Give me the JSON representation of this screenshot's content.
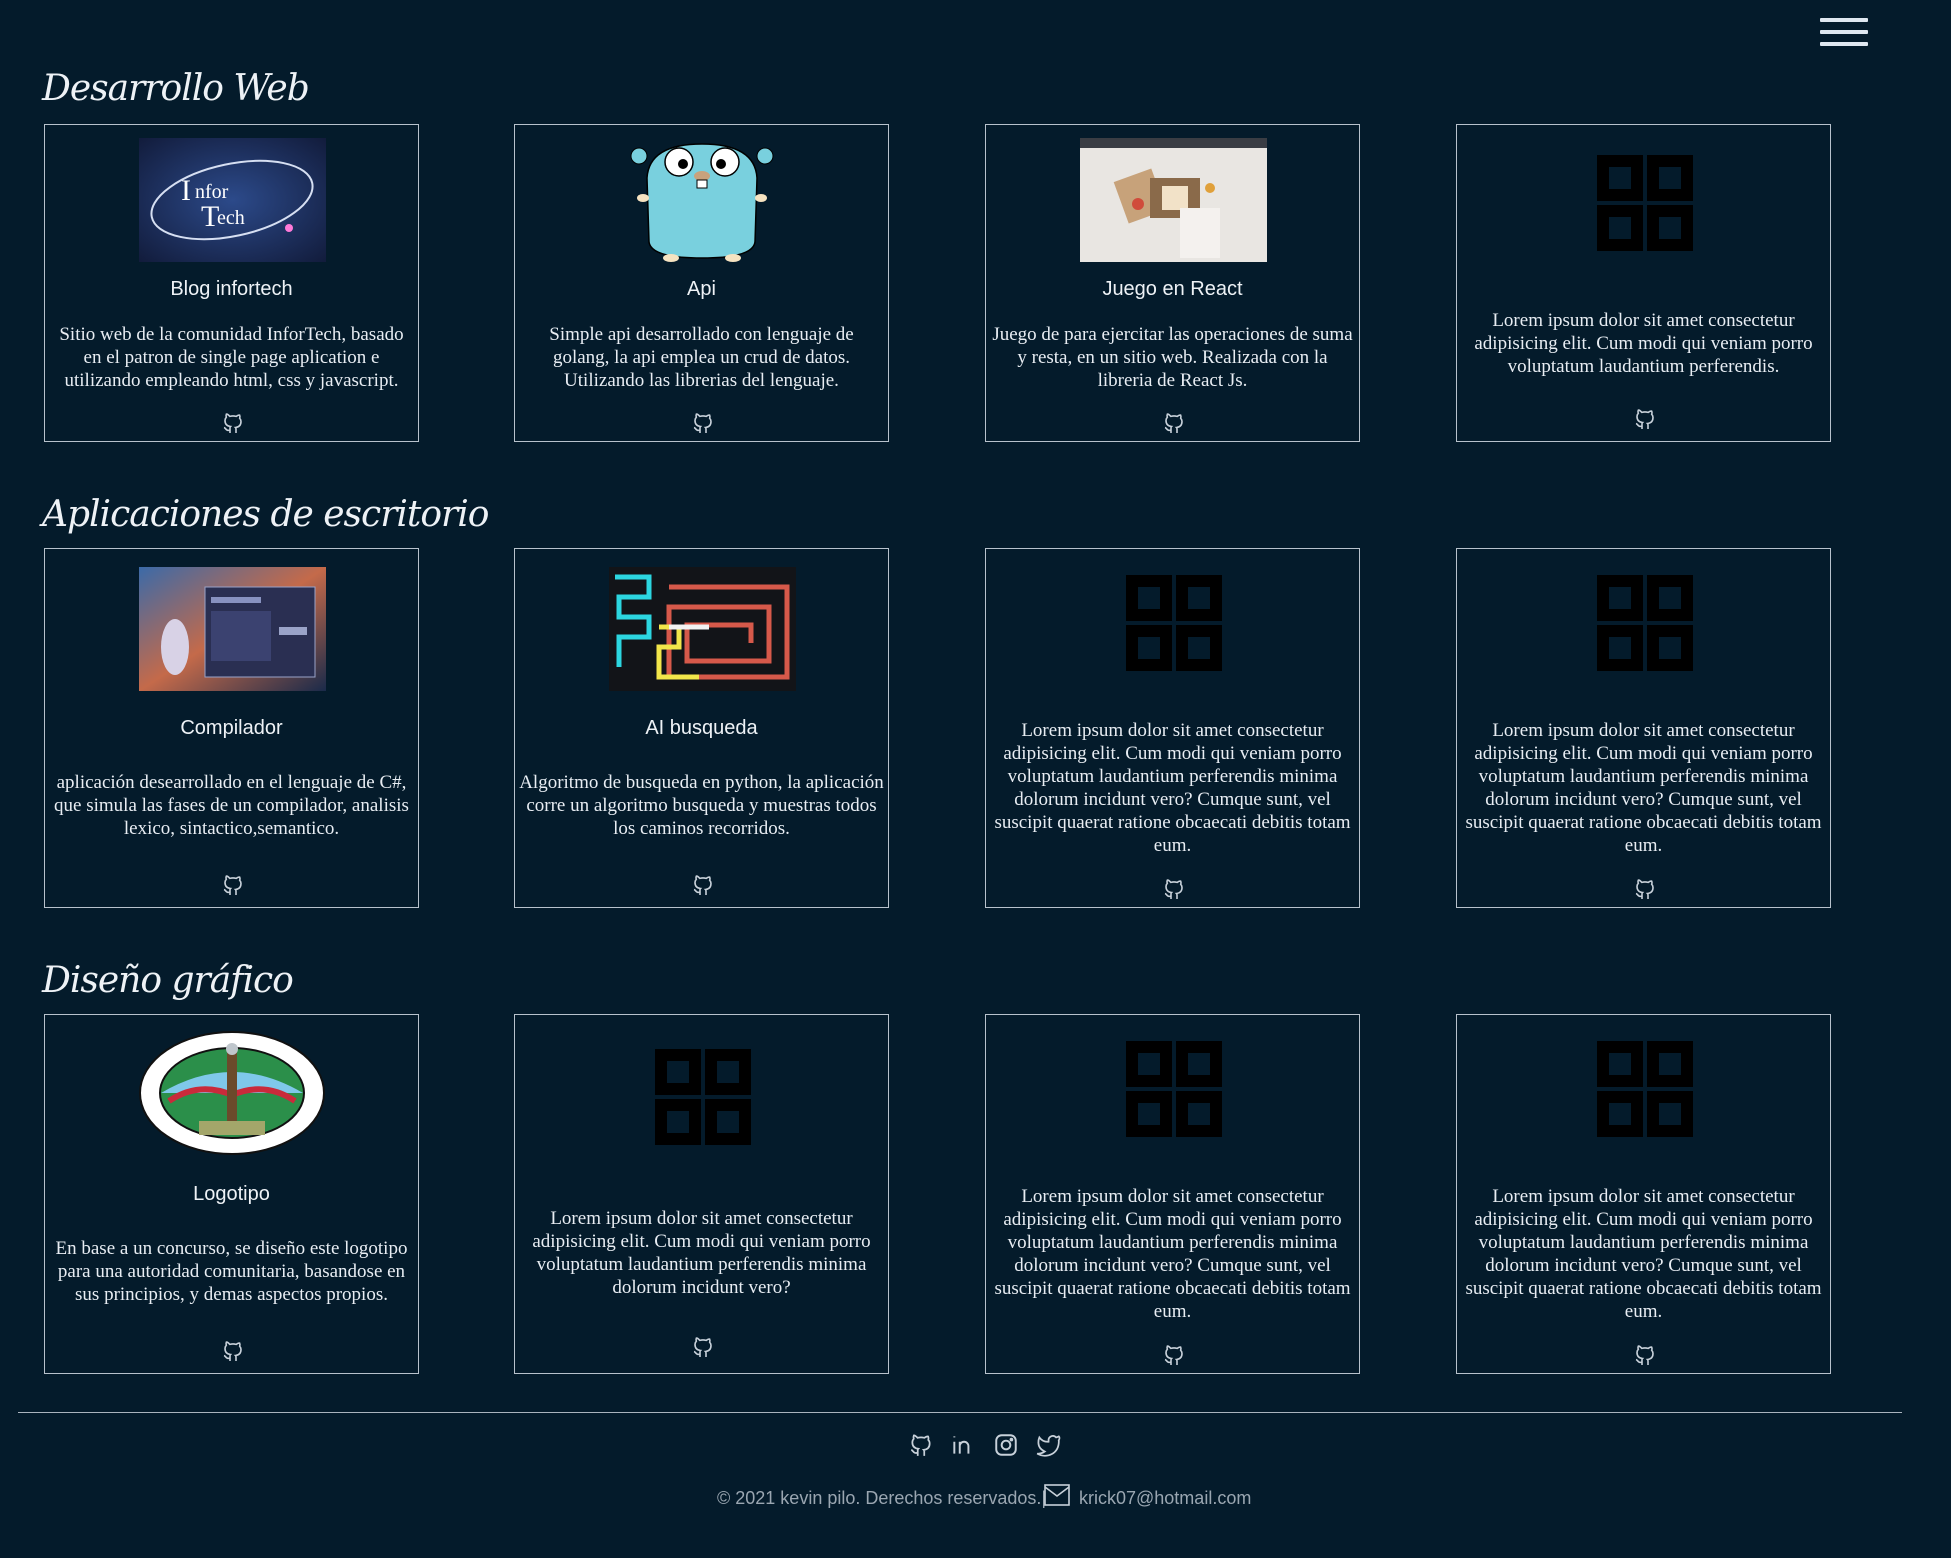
{
  "nav": {
    "menu_icon": "hamburger-menu-icon"
  },
  "sections": [
    {
      "title": "Desarrollo Web",
      "cards": [
        {
          "title": "Blog infortech",
          "description": "Sitio web de la comunidad InforTech, basado en el patron de single page aplication e utilizando empleando html, css y javascript.",
          "thumb": "infortech-logo"
        },
        {
          "title": "Api",
          "description": "Simple api desarrollado con lenguaje de golang, la api emplea un crud de datos. Utilizando las librerias del lenguaje.",
          "thumb": "gopher-mascot"
        },
        {
          "title": "Juego en React",
          "description": "Juego de para ejercitar las operaciones de suma y resta, en un sitio web. Realizada con la libreria de React Js.",
          "thumb": "react-game-screenshot"
        },
        {
          "title": "",
          "description": "Lorem ipsum dolor sit amet consectetur adipisicing elit. Cum modi qui veniam porro voluptatum laudantium perferendis.",
          "thumb": "grid-placeholder-icon"
        }
      ]
    },
    {
      "title": "Aplicaciones de escritorio",
      "cards": [
        {
          "title": "Compilador",
          "description": "aplicación desearrollado en el lenguaje de C#, que simula las fases de un compilador, analisis lexico, sintactico,semantico.",
          "thumb": "compiler-screenshot"
        },
        {
          "title": "AI busqueda",
          "description": "Algoritmo de busqueda en python, la aplicación corre un algoritmo busqueda y muestras todos los caminos recorridos.",
          "thumb": "maze-screenshot"
        },
        {
          "title": "",
          "description": "Lorem ipsum dolor sit amet consectetur adipisicing elit. Cum modi qui veniam porro voluptatum laudantium perferendis minima dolorum incidunt vero? Cumque sunt, vel suscipit quaerat ratione obcaecati debitis totam eum.",
          "thumb": "grid-placeholder-icon"
        },
        {
          "title": "",
          "description": "Lorem ipsum dolor sit amet consectetur adipisicing elit. Cum modi qui veniam porro voluptatum laudantium perferendis minima dolorum incidunt vero? Cumque sunt, vel suscipit quaerat ratione obcaecati debitis totam eum.",
          "thumb": "grid-placeholder-icon"
        }
      ]
    },
    {
      "title": "Diseño gráfico",
      "cards": [
        {
          "title": "Logotipo",
          "description": "En base a un concurso, se diseño este logotipo para una autoridad comunitaria, basandose en sus principios, y demas aspectos propios.",
          "thumb": "community-logo"
        },
        {
          "title": "",
          "description": "Lorem ipsum dolor sit amet consectetur adipisicing elit. Cum modi qui veniam porro voluptatum laudantium perferendis minima dolorum incidunt vero?",
          "thumb": "grid-placeholder-icon"
        },
        {
          "title": "",
          "description": "Lorem ipsum dolor sit amet consectetur adipisicing elit. Cum modi qui veniam porro voluptatum laudantium perferendis minima dolorum incidunt vero? Cumque sunt, vel suscipit quaerat ratione obcaecati debitis totam eum.",
          "thumb": "grid-placeholder-icon"
        },
        {
          "title": "",
          "description": "Lorem ipsum dolor sit amet consectetur adipisicing elit. Cum modi qui veniam porro voluptatum laudantium perferendis minima dolorum incidunt vero? Cumque sunt, vel suscipit quaerat ratione obcaecati debitis totam eum.",
          "thumb": "grid-placeholder-icon"
        }
      ]
    }
  ],
  "footer": {
    "social_icons": [
      "github-icon",
      "linkedin-icon",
      "instagram-icon",
      "twitter-icon"
    ],
    "copyright": "© 2021 kevin pilo. Derechos reservados.|",
    "email": "krick07@hotmail.com",
    "mail_icon": "mail-icon"
  },
  "colors": {
    "background": "#041b2b",
    "border": "#b8c2cc",
    "text": "#e8edf3",
    "footer_text": "#9aa6b1"
  }
}
